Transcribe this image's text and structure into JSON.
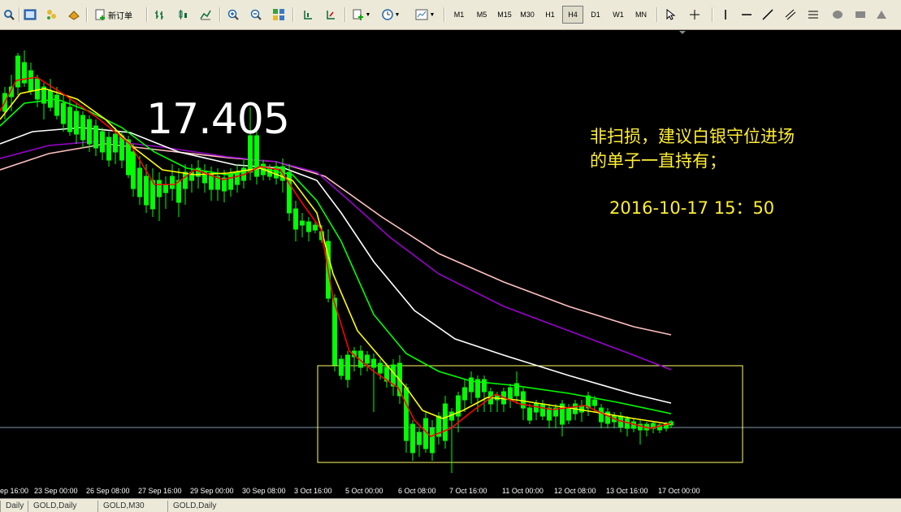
{
  "toolbar": {
    "new_order_label": "新订单",
    "timeframes": [
      "M1",
      "M5",
      "M15",
      "M30",
      "H1",
      "H4",
      "D1",
      "W1",
      "MN"
    ],
    "active_timeframe": "H4"
  },
  "chart": {
    "price_label": "17.405",
    "annotation_line1": "非扫损，建议白银守位进场",
    "annotation_line2": "的单子一直持有；",
    "annotation_datetime": "2016-10-17  15：50",
    "colors": {
      "background": "#000000",
      "ma_fast": "#ff0000",
      "ma_yellow": "#ffff00",
      "ma_green": "#00ff00",
      "ma_white": "#ffffff",
      "ma_purple": "#9900cc",
      "ma_pink": "#ffc0c0",
      "highlight_box": "#ffff66",
      "bid_line": "#8899aa"
    }
  },
  "x_axis": {
    "labels": [
      "ep 16:00",
      "23 Sep 00:00",
      "26 Sep 08:00",
      "27 Sep 16:00",
      "29 Sep 00:00",
      "30 Sep 08:00",
      "3 Oct 16:00",
      "5 Oct 00:00",
      "6 Oct 08:00",
      "7 Oct 16:00",
      "11 Oct 00:00",
      "12 Oct 08:00",
      "13 Oct 16:00",
      "17 Oct 00:00"
    ]
  },
  "tabs": [
    "Daily",
    "GOLD,Daily",
    "GOLD,M30",
    "GOLD,Daily"
  ]
}
